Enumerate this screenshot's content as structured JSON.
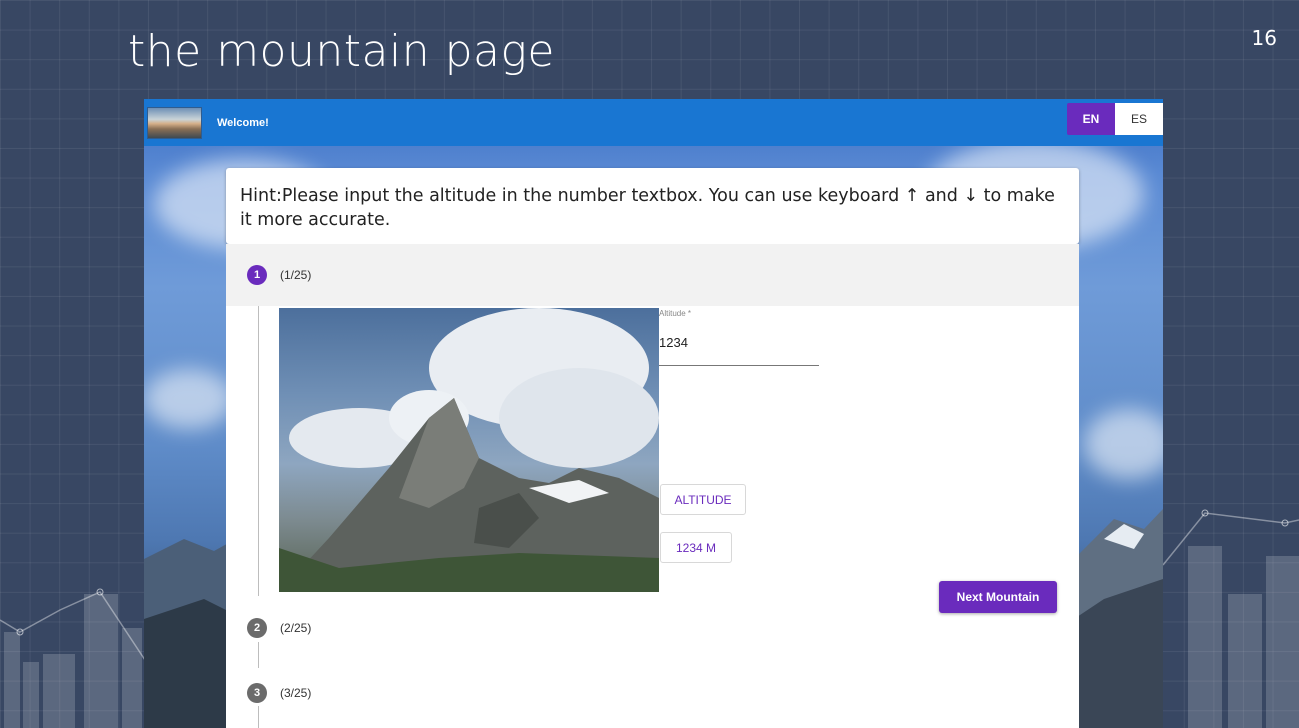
{
  "slide": {
    "title": "the mountain page",
    "page_number": "16"
  },
  "app": {
    "header": {
      "welcome": "Welcome!",
      "languages": [
        "EN",
        "ES"
      ],
      "active_language": "EN"
    },
    "hint": "Hint:Please input the altitude in the number textbox. You can use keyboard ↑ and ↓ to make it more accurate.",
    "steps": [
      {
        "number": "1",
        "label": "(1/25)",
        "active": true
      },
      {
        "number": "2",
        "label": "(2/25)",
        "active": false
      },
      {
        "number": "3",
        "label": "(3/25)",
        "active": false
      }
    ],
    "altitude_field": {
      "label": "Altitude *",
      "value": "1234"
    },
    "buttons": {
      "altitude": "ALTITUDE",
      "result": "1234 M",
      "next": "Next Mountain"
    },
    "colors": {
      "appbar": "#1976d2",
      "accent": "#6a2bbd",
      "slide_background": "#384763"
    }
  }
}
